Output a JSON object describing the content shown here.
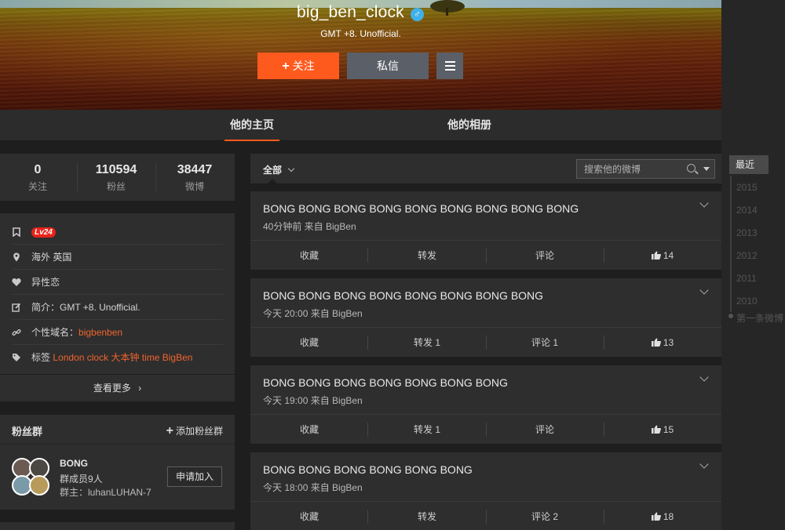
{
  "profile": {
    "name": "big_ben_clock",
    "gender_icon": "male-icon",
    "description": "GMT +8. Unofficial.",
    "follow_label": "关注",
    "message_label": "私信"
  },
  "tabs": [
    {
      "label": "他的主页",
      "active": true
    },
    {
      "label": "他的相册",
      "active": false
    }
  ],
  "stats": [
    {
      "value": "0",
      "label": "关注"
    },
    {
      "value": "110594",
      "label": "粉丝"
    },
    {
      "value": "38447",
      "label": "微博"
    }
  ],
  "info": {
    "level": "Lv24",
    "location": "海外 英国",
    "orientation": "异性恋",
    "bio_label": "简介：",
    "bio_value": "GMT +8. Unofficial.",
    "domain_label": "个性域名：",
    "domain_value": "bigbenben",
    "tags_label": "标签",
    "tags_value": "London clock 大本钟 time BigBen",
    "more_label": "查看更多"
  },
  "fan_group": {
    "title": "粉丝群",
    "add_label": "添加粉丝群",
    "group_name": "BONG",
    "members": "群成员9人",
    "owner": "群主：luhanLUHAN-7",
    "join_label": "申请加入"
  },
  "feed": {
    "filter_label": "全部",
    "search_placeholder": "搜索他的微博",
    "posts": [
      {
        "text": "BONG BONG BONG BONG BONG BONG BONG BONG BONG",
        "meta": "40分钟前 来自 BigBen",
        "fav": "收藏",
        "repost": "转发",
        "comment": "评论",
        "likes": "14"
      },
      {
        "text": "BONG BONG BONG BONG BONG BONG BONG BONG",
        "meta": "今天 20:00 来自 BigBen",
        "fav": "收藏",
        "repost": "转发 1",
        "comment": "评论 1",
        "likes": "13"
      },
      {
        "text": "BONG BONG BONG BONG BONG BONG BONG",
        "meta": "今天 19:00 来自 BigBen",
        "fav": "收藏",
        "repost": "转发 1",
        "comment": "评论",
        "likes": "15"
      },
      {
        "text": "BONG BONG BONG BONG BONG BONG",
        "meta": "今天 18:00 来自 BigBen",
        "fav": "收藏",
        "repost": "转发",
        "comment": "评论 2",
        "likes": "18"
      }
    ]
  },
  "timeline": {
    "current": "最近",
    "years": [
      "2015",
      "2014",
      "2013",
      "2012",
      "2011",
      "2010"
    ],
    "first_post": "第一条微博"
  },
  "colors": {
    "accent": "#ff5a1e",
    "link": "#f0642d",
    "badge": "#e8231a",
    "gender": "#3fb1e8"
  }
}
